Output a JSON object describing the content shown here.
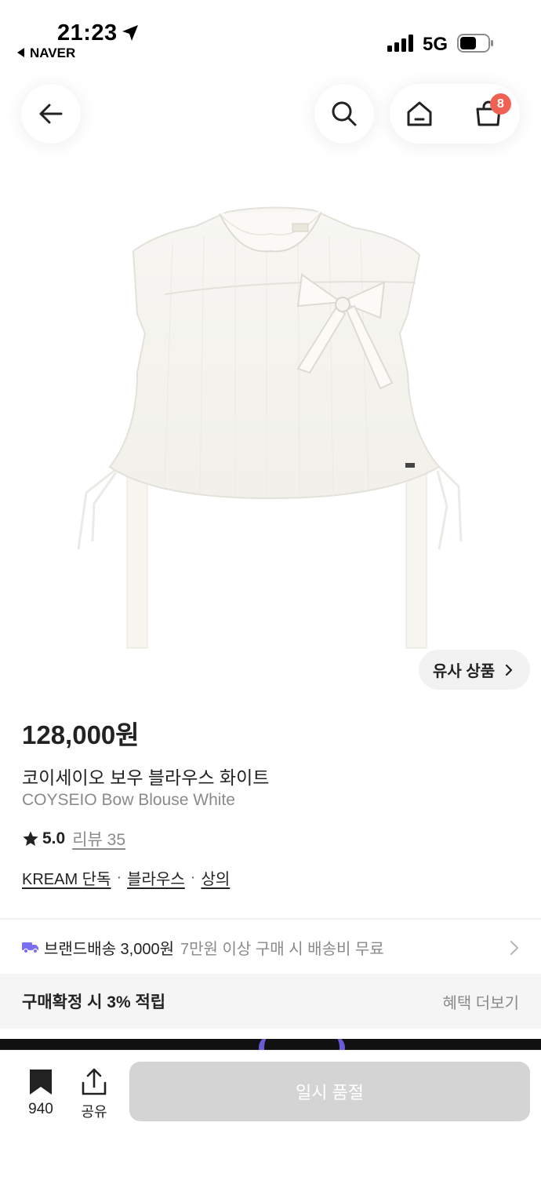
{
  "status_bar": {
    "time": "21:23",
    "back_app": "NAVER",
    "network": "5G",
    "icons": [
      "location-arrow-icon",
      "signal-icon",
      "battery-icon"
    ]
  },
  "nav": {
    "icons": [
      "arrow-left-icon",
      "search-icon",
      "home-icon",
      "cart-icon"
    ],
    "cart_badge": "8",
    "badge_color": "#ef6253"
  },
  "product": {
    "image_icon": "white-bow-blouse-image",
    "similar_label": "유사 상품",
    "price": "128,000원",
    "name_ko": "코이세이오 보우 블라우스 화이트",
    "name_en": "COYSEIO Bow Blouse White",
    "rating": "5.0",
    "review_label": "리뷰 35",
    "tags": [
      "KREAM 단독",
      "블라우스",
      "상의"
    ],
    "tag_separator": "·"
  },
  "delivery": {
    "icon": "truck-icon",
    "icon_color": "#7a6ff0",
    "main": "브랜드배송 3,000원",
    "sub": "7만원 이상 구매 시 배송비 무료"
  },
  "benefit": {
    "title": "구매확정 시 3% 적립",
    "more": "혜택 더보기"
  },
  "bottom_bar": {
    "wish_count": "940",
    "share_label": "공유",
    "soldout_label": "일시 품절"
  }
}
